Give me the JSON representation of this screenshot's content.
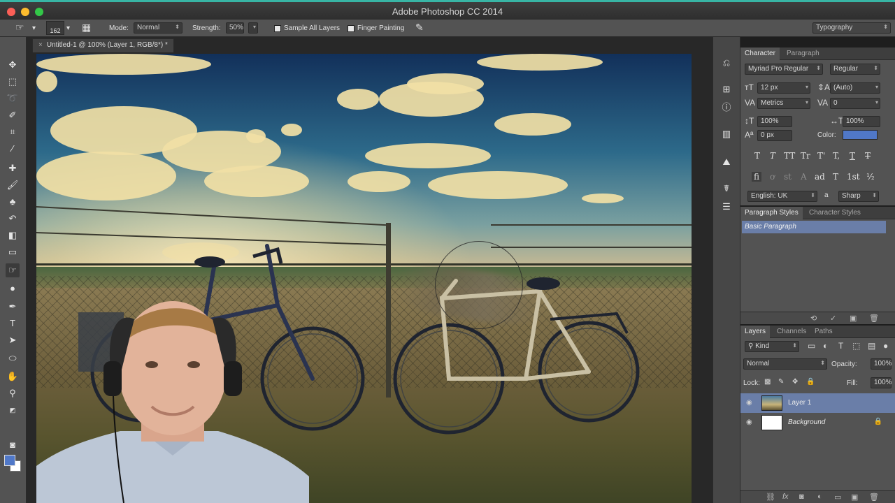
{
  "titlebar": {
    "app_title": "Adobe Photoshop CC 2014"
  },
  "options_bar": {
    "brush_size": "162",
    "mode_label": "Mode:",
    "mode_value": "Normal",
    "strength_label": "Strength:",
    "strength_value": "50%",
    "sample_all_layers": "Sample All Layers",
    "finger_painting": "Finger Painting",
    "workspace": "Typography"
  },
  "document": {
    "tab_title": "Untitled-1 @ 100% (Layer 1, RGB/8*) *"
  },
  "colors": {
    "foreground": "#5078c8",
    "background": "#ffffff",
    "accent_selection": "#6a7ea8"
  },
  "character_panel": {
    "tabs": [
      "Character",
      "Paragraph"
    ],
    "font_family": "Myriad Pro Regular",
    "font_style": "Regular",
    "font_size": "12 px",
    "leading": "(Auto)",
    "kerning": "Metrics",
    "tracking": "0",
    "vertical_scale": "100%",
    "horizontal_scale": "100%",
    "baseline_shift": "0 px",
    "color_label": "Color:",
    "color_value": "#5078c8",
    "type_styles": [
      "T",
      "T",
      "TT",
      "Tr",
      "T'",
      "T,",
      "T",
      "T"
    ],
    "opentype": [
      "fi",
      "ơ",
      "st",
      "A",
      "ad",
      "T",
      "1st",
      "½"
    ],
    "language": "English: UK",
    "aa_label": "a",
    "antialias": "Sharp"
  },
  "paragraph_styles_panel": {
    "tabs": [
      "Paragraph Styles",
      "Character Styles"
    ],
    "items": [
      "Basic Paragraph"
    ]
  },
  "layers_panel": {
    "tabs": [
      "Layers",
      "Channels",
      "Paths"
    ],
    "filter_kind": "Kind",
    "blend_mode": "Normal",
    "opacity_label": "Opacity:",
    "opacity_value": "100%",
    "lock_label": "Lock:",
    "fill_label": "Fill:",
    "fill_value": "100%",
    "layers": [
      {
        "name": "Layer 1",
        "selected": true
      },
      {
        "name": "Background",
        "selected": false,
        "locked": true
      }
    ]
  }
}
